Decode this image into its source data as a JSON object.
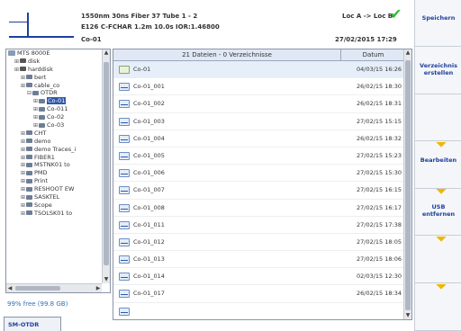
{
  "header": {
    "measurement_line1": "1550nm 30ns Fiber 37 Tube 1 - 2",
    "measurement_line2": "E126 C-FCHAR 1.2m 10.0s IOR:1.46800",
    "file_id": "Co-01",
    "route": "Loc A -> Loc B",
    "datetime": "27/02/2015 17:29"
  },
  "tree": {
    "items": [
      {
        "label": "MTS 8000E",
        "level": 0,
        "icon": "device-icon"
      },
      {
        "label": "disk",
        "level": 1,
        "icon": "disk-icon"
      },
      {
        "label": "harddisk",
        "level": 1,
        "icon": "disk-icon"
      },
      {
        "label": "bert",
        "level": 2,
        "icon": "folder-icon"
      },
      {
        "label": "cable_co",
        "level": 2,
        "icon": "folder-icon"
      },
      {
        "label": "OTDR",
        "level": 3,
        "icon": "folder-icon"
      },
      {
        "label": "Co-01",
        "level": 4,
        "icon": "folder-icon",
        "selected": true
      },
      {
        "label": "Co-011",
        "level": 4,
        "icon": "folder-icon"
      },
      {
        "label": "Co-02",
        "level": 4,
        "icon": "folder-icon"
      },
      {
        "label": "Co-03",
        "level": 4,
        "icon": "folder-icon"
      },
      {
        "label": "CHT",
        "level": 2,
        "icon": "folder-icon"
      },
      {
        "label": "demo",
        "level": 2,
        "icon": "folder-icon"
      },
      {
        "label": "demo Traces_i",
        "level": 2,
        "icon": "folder-icon"
      },
      {
        "label": "FIBER1",
        "level": 2,
        "icon": "folder-icon"
      },
      {
        "label": "MSTNK01 to",
        "level": 2,
        "icon": "folder-icon"
      },
      {
        "label": "PMD",
        "level": 2,
        "icon": "folder-icon"
      },
      {
        "label": "Print",
        "level": 2,
        "icon": "folder-icon"
      },
      {
        "label": "RESHOOT EW",
        "level": 2,
        "icon": "folder-icon"
      },
      {
        "label": "SASKTEL",
        "level": 2,
        "icon": "folder-icon"
      },
      {
        "label": "Scope",
        "level": 2,
        "icon": "folder-icon"
      },
      {
        "label": "TSOLSK01 to",
        "level": 2,
        "icon": "folder-icon"
      }
    ]
  },
  "free_space": "99% free (99.8 GB)",
  "tab_label": "SM-OTDR",
  "filelist": {
    "header_name": "21 Dateien - 0 Verzeichnisse",
    "header_date": "Datum",
    "rows": [
      {
        "name": "Co-01",
        "date": "04/03/15 16:26",
        "icon": "plain"
      },
      {
        "name": "Co-01_001",
        "date": "26/02/15 18:30",
        "icon": "trace"
      },
      {
        "name": "Co-01_002",
        "date": "26/02/15 18:31",
        "icon": "trace"
      },
      {
        "name": "Co-01_003",
        "date": "27/02/15 15:15",
        "icon": "trace"
      },
      {
        "name": "Co-01_004",
        "date": "26/02/15 18:32",
        "icon": "trace"
      },
      {
        "name": "Co-01_005",
        "date": "27/02/15 15:23",
        "icon": "trace"
      },
      {
        "name": "Co-01_006",
        "date": "27/02/15 15:30",
        "icon": "trace"
      },
      {
        "name": "Co-01_007",
        "date": "27/02/15 16:15",
        "icon": "trace"
      },
      {
        "name": "Co-01_008",
        "date": "27/02/15 16:17",
        "icon": "trace"
      },
      {
        "name": "Co-01_011",
        "date": "27/02/15 17:38",
        "icon": "trace"
      },
      {
        "name": "Co-01_012",
        "date": "27/02/15 18:05",
        "icon": "trace"
      },
      {
        "name": "Co-01_013",
        "date": "27/02/15 18:06",
        "icon": "trace"
      },
      {
        "name": "Co-01_014",
        "date": "02/03/15 12:30",
        "icon": "trace"
      },
      {
        "name": "Co-01_017",
        "date": "26/02/15 18:34",
        "icon": "trace"
      },
      {
        "name": "",
        "date": "",
        "icon": "trace"
      }
    ]
  },
  "softkeys": [
    {
      "label": "Speichern",
      "submenu": false
    },
    {
      "label": "Verzeichnis erstellen",
      "submenu": false
    },
    {
      "label": "",
      "submenu": false
    },
    {
      "label": "Bearbeiten",
      "submenu": true
    },
    {
      "label": "USB entfernen",
      "submenu": true
    },
    {
      "label": "",
      "submenu": true
    },
    {
      "label": "",
      "submenu": true
    }
  ],
  "colors": {
    "accent": "#1f3f9c",
    "selection": "#2d5aa8",
    "ok_check": "#35b535",
    "submenu_marker": "#f2b600"
  }
}
